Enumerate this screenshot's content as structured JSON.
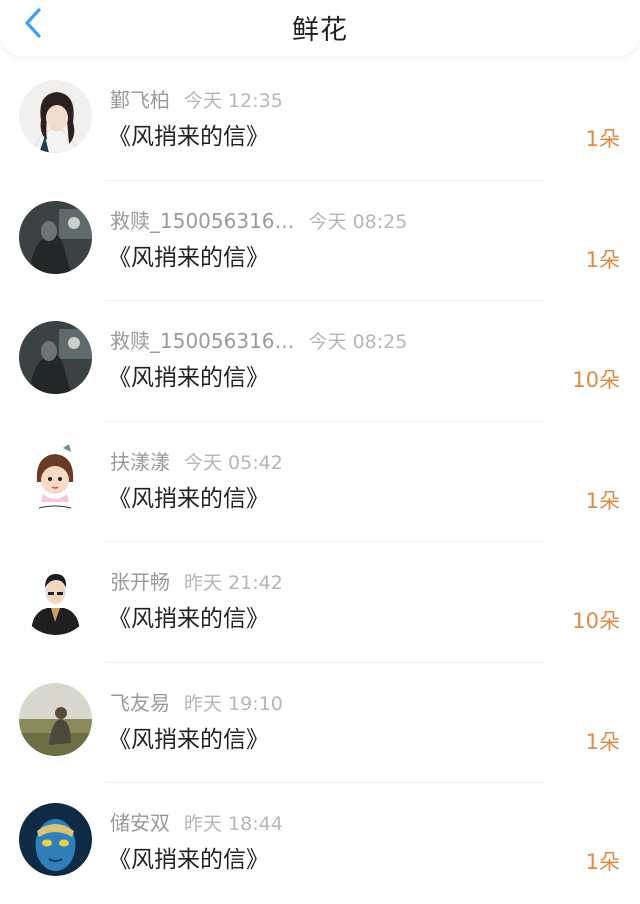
{
  "header": {
    "title": "鲜花",
    "back_icon": "chevron-left-icon",
    "accent": "#3a9ff0"
  },
  "count_color": "#e08a46",
  "gifts": [
    {
      "name": "鄞飞柏",
      "time": "今天 12:35",
      "book": "《风捎来的信》",
      "count": "1朵",
      "avatar": "girl-avatar"
    },
    {
      "name": "救赎_150056316…",
      "time": "今天 08:25",
      "book": "《风捎来的信》",
      "count": "1朵",
      "avatar": "dark-photo-avatar"
    },
    {
      "name": "救赎_150056316…",
      "time": "今天 08:25",
      "book": "《风捎来的信》",
      "count": "10朵",
      "avatar": "dark-photo-avatar"
    },
    {
      "name": "扶漾漾",
      "time": "今天 05:42",
      "book": "《风捎来的信》",
      "count": "1朵",
      "avatar": "cartoon-girl-avatar"
    },
    {
      "name": "张开畅",
      "time": "昨天 21:42",
      "book": "《风捎来的信》",
      "count": "10朵",
      "avatar": "man-black-jacket-avatar"
    },
    {
      "name": "飞友易",
      "time": "昨天 19:10",
      "book": "《风捎来的信》",
      "count": "1朵",
      "avatar": "field-photo-avatar"
    },
    {
      "name": "储安双",
      "time": "昨天 18:44",
      "book": "《风捎来的信》",
      "count": "1朵",
      "avatar": "blue-face-avatar"
    }
  ]
}
